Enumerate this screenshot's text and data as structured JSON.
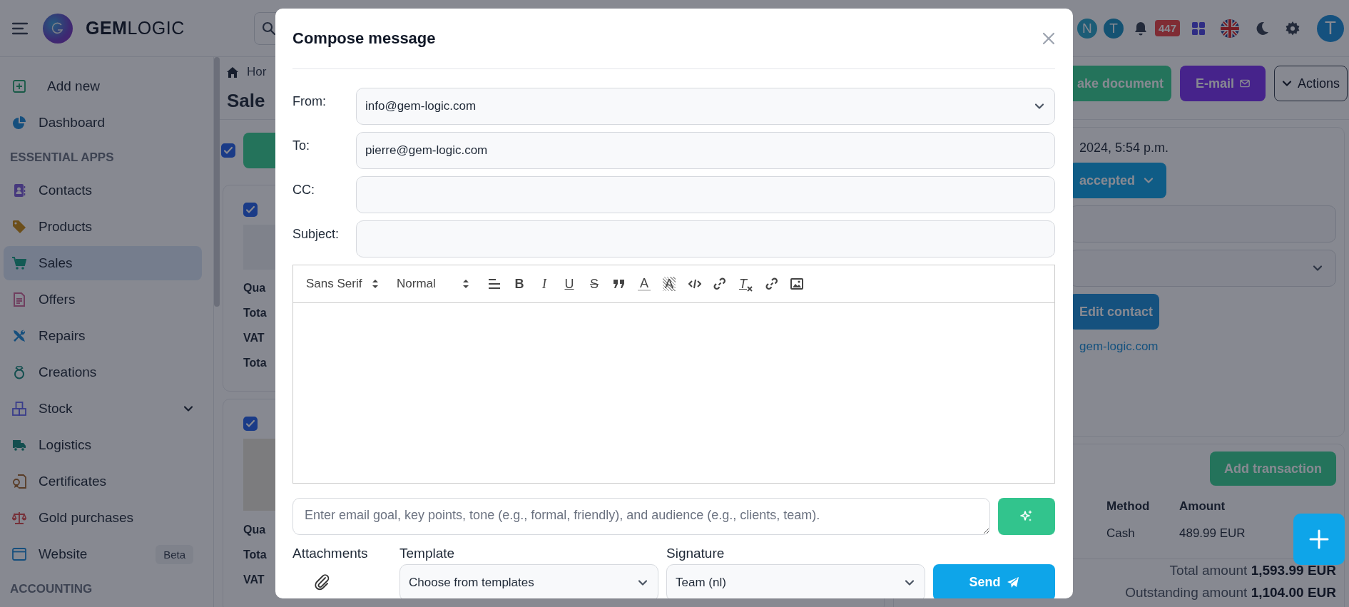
{
  "header": {
    "logo": "**GEM**LOGIC",
    "avatars": [
      {
        "initial": "N",
        "color": "#1c5c76"
      },
      {
        "initial": "T",
        "color": "#145272"
      }
    ],
    "notification_count": "447",
    "user_initial": "T"
  },
  "sidebar": {
    "items": [
      {
        "kind": "action",
        "label": "Add new",
        "selected": false
      },
      {
        "kind": "link",
        "label": "Dashboard",
        "selected": false
      },
      {
        "kind": "section",
        "label": "ESSENTIAL APPS"
      },
      {
        "kind": "link",
        "label": "Contacts",
        "selected": false
      },
      {
        "kind": "link",
        "label": "Products",
        "selected": false
      },
      {
        "kind": "link",
        "label": "Sales",
        "selected": true
      },
      {
        "kind": "link",
        "label": "Offers",
        "selected": false
      },
      {
        "kind": "link",
        "label": "Repairs",
        "selected": false
      },
      {
        "kind": "link",
        "label": "Creations",
        "selected": false
      },
      {
        "kind": "link",
        "label": "Stock",
        "selected": false,
        "expanded": false
      },
      {
        "kind": "link",
        "label": "Logistics",
        "selected": false
      },
      {
        "kind": "link",
        "label": "Certificates",
        "selected": false
      },
      {
        "kind": "link",
        "label": "Gold purchases",
        "selected": false
      },
      {
        "kind": "link",
        "label": "Website",
        "selected": false,
        "badge": "Beta"
      },
      {
        "kind": "section",
        "label": "ACCOUNTING"
      }
    ]
  },
  "page": {
    "breadcrumb": "Hor",
    "title": "Sale",
    "select_all_checked": true,
    "cards": [
      {
        "checked": true,
        "labels": [
          "Qua",
          "Tota",
          "VAT",
          "Tota"
        ]
      },
      {
        "checked": true,
        "labels": [
          "Qua",
          "Tota",
          "VAT"
        ]
      }
    ],
    "buttons": [
      {
        "kind": "primary",
        "label": "ake document"
      },
      {
        "kind": "email",
        "label": "E-mail"
      },
      {
        "kind": "dropdown",
        "label": "Actions"
      }
    ],
    "details": {
      "date": "2024, 5:54 p.m.",
      "status": "accepted",
      "edit_button": "Edit contact",
      "email_link": "gem-logic.com"
    },
    "transactions": {
      "add_button": "Add transaction",
      "columns": [
        "Method",
        "Amount"
      ],
      "rows": [
        [
          "Cash",
          "489.99 EUR"
        ]
      ],
      "total": "Total amount **1,593.99 EUR**",
      "outstanding": "Outstanding amount **1,104.00 EUR**"
    }
  },
  "modal": {
    "title": "Compose message",
    "fields": [
      {
        "kind": "select",
        "label": "From:",
        "value": "info@gem-logic.com"
      },
      {
        "kind": "input",
        "label": "To:",
        "value": "pierre@gem-logic.com"
      },
      {
        "kind": "input",
        "label": "CC:"
      },
      {
        "kind": "input",
        "label": "Subject:"
      }
    ],
    "toolbar": [
      [
        {
          "kind": "select",
          "label": "Sans Serif"
        },
        {
          "kind": "select",
          "label": "Normal"
        }
      ],
      [
        {
          "kind": "align"
        },
        {
          "kind": "bold",
          "text": "B"
        },
        {
          "kind": "italic",
          "text": "I"
        },
        {
          "kind": "underline",
          "text": "U"
        },
        {
          "kind": "strike",
          "text": "S"
        },
        {
          "kind": "quote"
        },
        {
          "kind": "color",
          "text": "A"
        },
        {
          "kind": "background",
          "text": "A"
        }
      ],
      [
        {
          "kind": "code"
        },
        {
          "kind": "link"
        }
      ],
      [
        {
          "kind": "clean",
          "text": "T"
        }
      ],
      [
        {
          "kind": "link"
        },
        {
          "kind": "image"
        }
      ]
    ],
    "ai_prompt": {
      "placeholder": "Enter email goal, key points, tone (e.g., formal, friendly), and audience (e.g., clients, team)."
    },
    "attachments_label": "Attachments",
    "template": {
      "label": "Template",
      "value": "Choose from templates"
    },
    "signature": {
      "label": "Signature",
      "value": "Team (nl)"
    },
    "send": "Send"
  }
}
